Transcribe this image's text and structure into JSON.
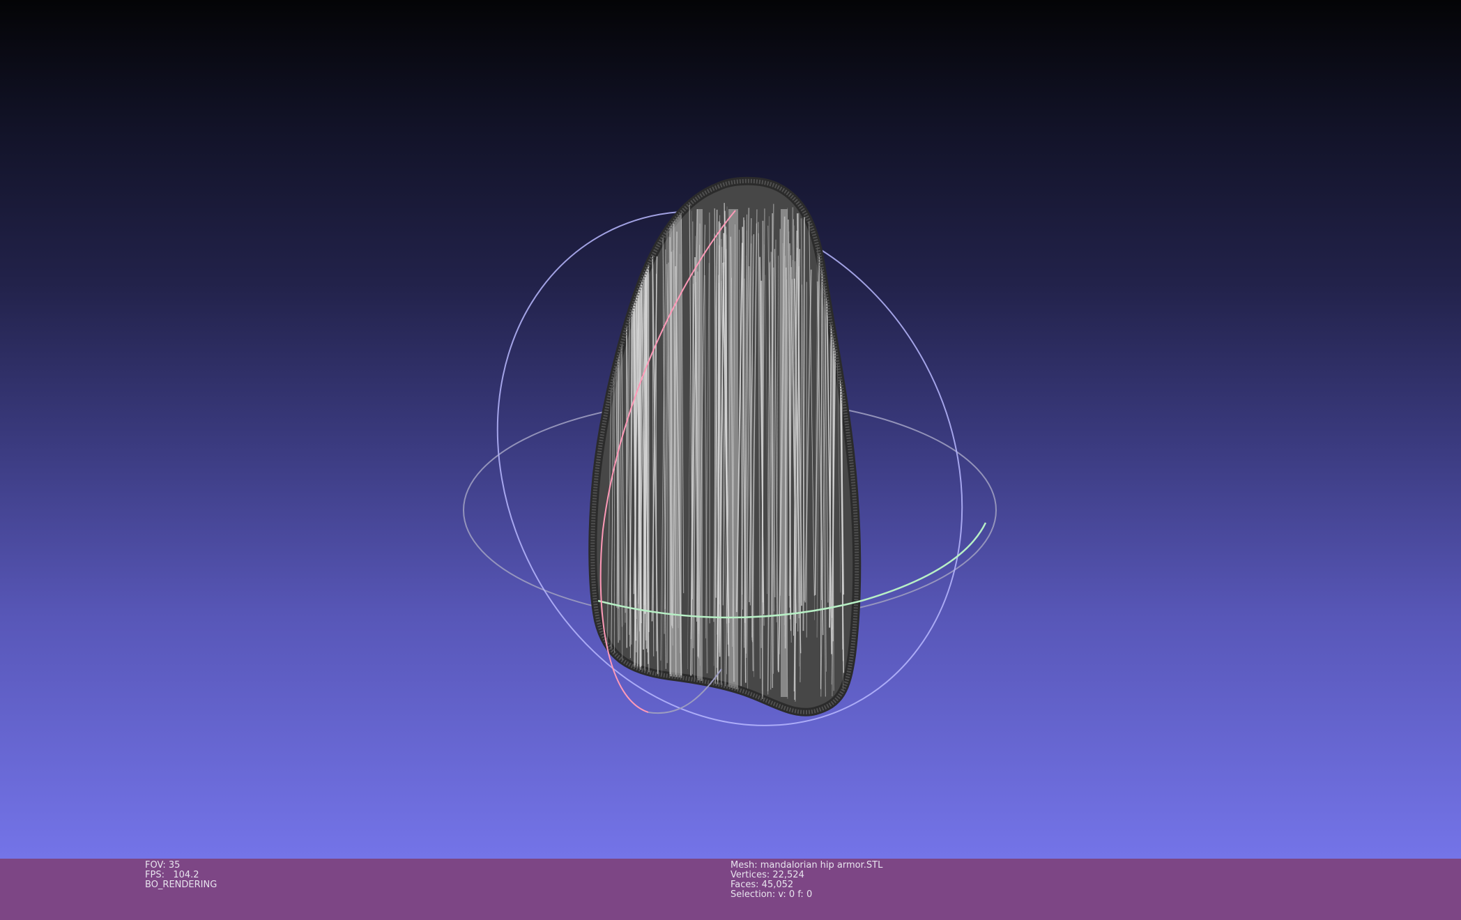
{
  "viewer": {
    "background_top": "#040406",
    "background_bottom": "#7474e8",
    "info_bar_color": "#7d4685",
    "mesh_color": "#444444",
    "mesh_line_color": "#d6d6d6",
    "trackball": {
      "ring_x_color": "#ff9ab8",
      "ring_y_color": "#b8f0c6",
      "ring_z_color": "#b8b8ff",
      "ring_neutral_color": "#9c9cc0"
    }
  },
  "render_info": {
    "fov": "FOV: 35",
    "fps": "FPS:   104.2",
    "mode": "BO_RENDERING"
  },
  "mesh_info": {
    "mesh": "Mesh: mandalorian hip armor.STL",
    "vertices": "Vertices: 22,524",
    "faces": "Faces: 45,052",
    "selection": "Selection: v: 0 f: 0"
  }
}
